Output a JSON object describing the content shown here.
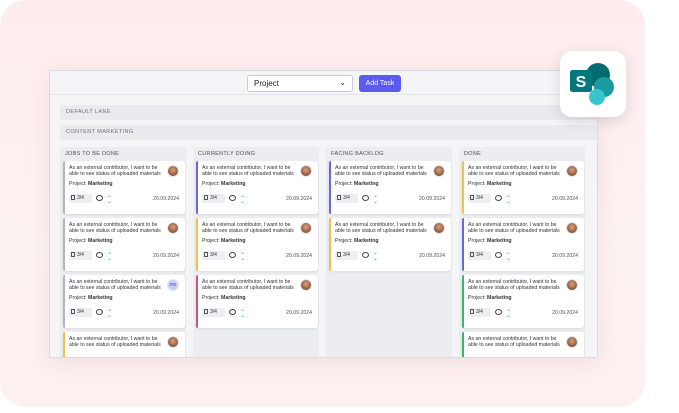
{
  "toolbar": {
    "project_select": "Project",
    "add_task_label": "Add Task"
  },
  "lanes": [
    "DEFAULT LANE",
    "CONTENT MARKETING"
  ],
  "columns": [
    {
      "title": "JOBS TO BE DONE",
      "cards": [
        {
          "desc": "As an external contributor, I want to be able to see status of uploaded materials",
          "proj_label": "Project:",
          "proj": "Marketing",
          "chip": "3/4",
          "date": "20.09.2024",
          "accent": "#b0b6c2",
          "avatar": "photo"
        },
        {
          "desc": "As an external contributor, I want to be able to see status of uploaded materials",
          "proj_label": "Project:",
          "proj": "Marketing",
          "chip": "3/4",
          "date": "20.09.2024",
          "accent": "#b0b6c2",
          "avatar": "photo"
        },
        {
          "desc": "As an external contributor, I want to be able to see status of uploaded materials",
          "proj_label": "Project:",
          "proj": "Marketing",
          "chip": "3/4",
          "date": "20.09.2024",
          "accent": "#b0b6c2",
          "avatar": "initials",
          "initials": "PS"
        },
        {
          "desc": "As an external contributor, I want to be able to see status of uploaded materials",
          "proj_label": "",
          "proj": "",
          "chip": "",
          "date": "",
          "accent": "#f0c24b",
          "avatar": "photo"
        }
      ]
    },
    {
      "title": "CURRENTLY DOING",
      "cards": [
        {
          "desc": "As an external contributor, I want to be able to see status of uploaded materials",
          "proj_label": "Project:",
          "proj": "Marketing",
          "chip": "3/4",
          "date": "20.09.2024",
          "accent": "#6c63e6",
          "avatar": "photo"
        },
        {
          "desc": "As an external contributor, I want to be able to see status of uploaded materials",
          "proj_label": "Project:",
          "proj": "Marketing",
          "chip": "3/4",
          "date": "20.09.2024",
          "accent": "#f0c24b",
          "avatar": "photo"
        },
        {
          "desc": "As an external contributor, I want to be able to see status of uploaded materials",
          "proj_label": "Project:",
          "proj": "Marketing",
          "chip": "3/4",
          "date": "20.09.2024",
          "accent": "#d94f7a",
          "avatar": "photo"
        }
      ]
    },
    {
      "title": "FACING BACKLOG",
      "cards": [
        {
          "desc": "As an external contributor, I want to be able to see status of uploaded materials",
          "proj_label": "Project:",
          "proj": "Marketing",
          "chip": "3/4",
          "date": "20.09.2024",
          "accent": "#6c63e6",
          "avatar": "photo"
        },
        {
          "desc": "As an external contributor, I want to be able to see status of uploaded materials",
          "proj_label": "Project:",
          "proj": "Marketing",
          "chip": "3/4",
          "date": "20.09.2024",
          "accent": "#f0c24b",
          "avatar": "photo"
        }
      ]
    },
    {
      "title": "DONE",
      "cards": [
        {
          "desc": "As an external contributor, I want to be able to see status of uploaded materials",
          "proj_label": "Project:",
          "proj": "Marketing",
          "chip": "3/4",
          "date": "20.09.2024",
          "accent": "#f0c24b",
          "avatar": "photo"
        },
        {
          "desc": "As an external contributor, I want to be able to see status of uploaded materials",
          "proj_label": "Project:",
          "proj": "Marketing",
          "chip": "3/4",
          "date": "20.09.2024",
          "accent": "#6c63e6",
          "avatar": "photo"
        },
        {
          "desc": "As an external contributor, I want to be able to see status of uploaded materials",
          "proj_label": "Project:",
          "proj": "Marketing",
          "chip": "3/4",
          "date": "20.09.2024",
          "accent": "#3cb371",
          "avatar": "photo"
        },
        {
          "desc": "As an external contributor, I want to be able to see status of uploaded materials",
          "proj_label": "",
          "proj": "",
          "chip": "",
          "date": "",
          "accent": "#3cb371",
          "avatar": "photo"
        }
      ]
    }
  ],
  "icons": {
    "dropdown": "chevron-down-icon",
    "attachment": "document-icon",
    "comment": "comment-icon",
    "priority": "double-chevron-down-icon",
    "app_tile": "sharepoint-logo-icon"
  },
  "colors": {
    "accent": "#5b5bf0",
    "priority_green": "#3cb371"
  }
}
